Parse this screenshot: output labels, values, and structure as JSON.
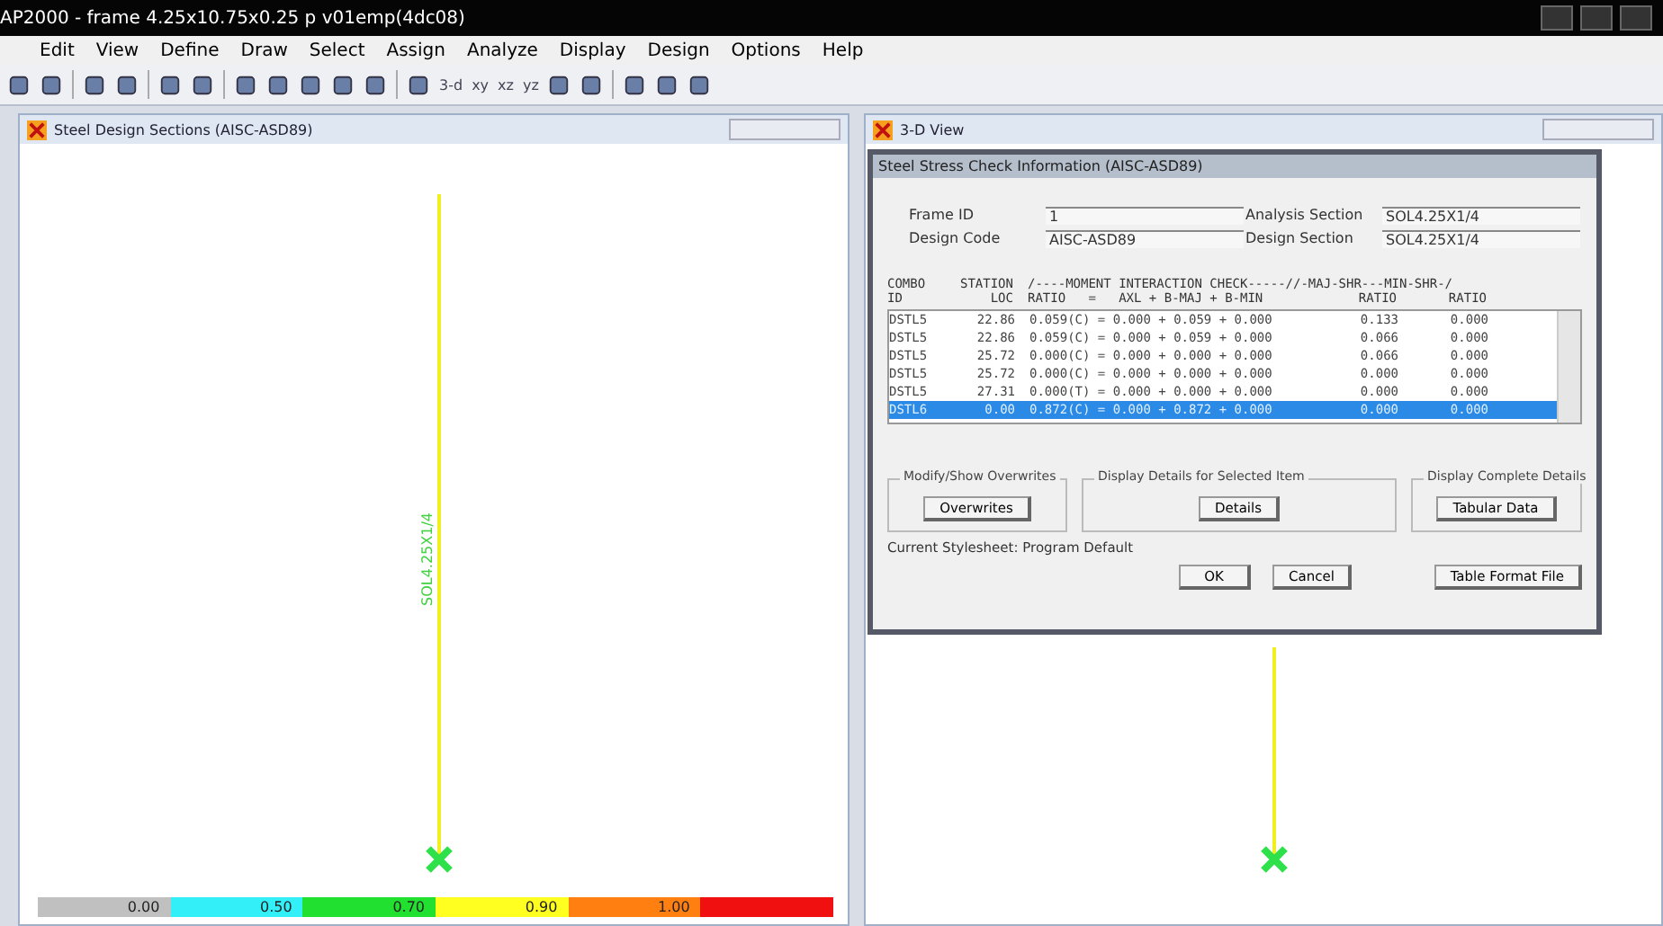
{
  "window": {
    "title": "AP2000 - frame 4.25x10.75x0.25 p v01emp(4dc08)"
  },
  "menu": [
    "Edit",
    "View",
    "Define",
    "Draw",
    "Select",
    "Assign",
    "Analyze",
    "Display",
    "Design",
    "Options",
    "Help"
  ],
  "toolbar": [
    {
      "kind": "icon"
    },
    {
      "kind": "icon"
    },
    {
      "kind": "sep"
    },
    {
      "kind": "icon"
    },
    {
      "kind": "icon"
    },
    {
      "kind": "sep"
    },
    {
      "kind": "icon"
    },
    {
      "kind": "icon"
    },
    {
      "kind": "sep"
    },
    {
      "kind": "icon"
    },
    {
      "kind": "icon"
    },
    {
      "kind": "icon"
    },
    {
      "kind": "icon"
    },
    {
      "kind": "icon"
    },
    {
      "kind": "sep"
    },
    {
      "kind": "icon"
    },
    {
      "kind": "text",
      "label": "3-d"
    },
    {
      "kind": "text",
      "label": "xy"
    },
    {
      "kind": "text",
      "label": "xz"
    },
    {
      "kind": "text",
      "label": "yz"
    },
    {
      "kind": "icon"
    },
    {
      "kind": "icon"
    },
    {
      "kind": "sep"
    },
    {
      "kind": "icon"
    },
    {
      "kind": "icon"
    },
    {
      "kind": "icon"
    }
  ],
  "left_pane": {
    "title": "Steel Design Sections  (AISC-ASD89)",
    "section_label": "SOL4.25X1/4",
    "legend": [
      {
        "label": "0.00",
        "color": "#c0c0c0"
      },
      {
        "label": "0.50",
        "color": "#33f0f8"
      },
      {
        "label": "0.70",
        "color": "#22e030"
      },
      {
        "label": "0.90",
        "color": "#ffff20"
      },
      {
        "label": "1.00",
        "color": "#ff8010"
      },
      {
        "color": "#f01010"
      }
    ]
  },
  "right_pane": {
    "title": "3-D View"
  },
  "dialog": {
    "title": "Steel Stress Check Information  (AISC-ASD89)",
    "fields": [
      {
        "label": "Frame ID",
        "value": "1"
      },
      {
        "label": "Analysis Section",
        "value": "SOL4.25X1/4"
      },
      {
        "label": "Design Code",
        "value": "AISC-ASD89"
      },
      {
        "label": "Design Section",
        "value": "SOL4.25X1/4"
      }
    ],
    "header": [
      [
        "COMBO",
        "STATION",
        "/----MOMENT INTERACTION CHECK-----//-MAJ-SHR---MIN-SHR-/"
      ],
      [
        "ID",
        "LOC",
        "RATIO   =   AXL + B-MAJ + B-MIN",
        "RATIO",
        "RATIO"
      ]
    ],
    "rows": [
      {
        "combo": "DSTL5",
        "loc": "22.86",
        "interaction": "0.059(C) = 0.000 + 0.059 + 0.000",
        "maj": "0.133",
        "min": "0.000",
        "selected": false
      },
      {
        "combo": "DSTL5",
        "loc": "22.86",
        "interaction": "0.059(C) = 0.000 + 0.059 + 0.000",
        "maj": "0.066",
        "min": "0.000",
        "selected": false
      },
      {
        "combo": "DSTL5",
        "loc": "25.72",
        "interaction": "0.000(C) = 0.000 + 0.000 + 0.000",
        "maj": "0.066",
        "min": "0.000",
        "selected": false
      },
      {
        "combo": "DSTL5",
        "loc": "25.72",
        "interaction": "0.000(C) = 0.000 + 0.000 + 0.000",
        "maj": "0.000",
        "min": "0.000",
        "selected": false
      },
      {
        "combo": "DSTL5",
        "loc": "27.31",
        "interaction": "0.000(T) = 0.000 + 0.000 + 0.000",
        "maj": "0.000",
        "min": "0.000",
        "selected": false
      },
      {
        "combo": "DSTL6",
        "loc": "0.00",
        "interaction": "0.872(C) = 0.000 + 0.872 + 0.000",
        "maj": "0.000",
        "min": "0.000",
        "selected": true
      }
    ],
    "groups": [
      {
        "legend": "Modify/Show Overwrites",
        "button": "Overwrites"
      },
      {
        "legend": "Display Details for Selected Item",
        "button": "Details"
      },
      {
        "legend": "Display Complete Details",
        "button": "Tabular Data"
      }
    ],
    "stylesheet": "Current Stylesheet:  Program Default",
    "buttons": [
      "OK",
      "Cancel",
      "Table Format File"
    ]
  }
}
